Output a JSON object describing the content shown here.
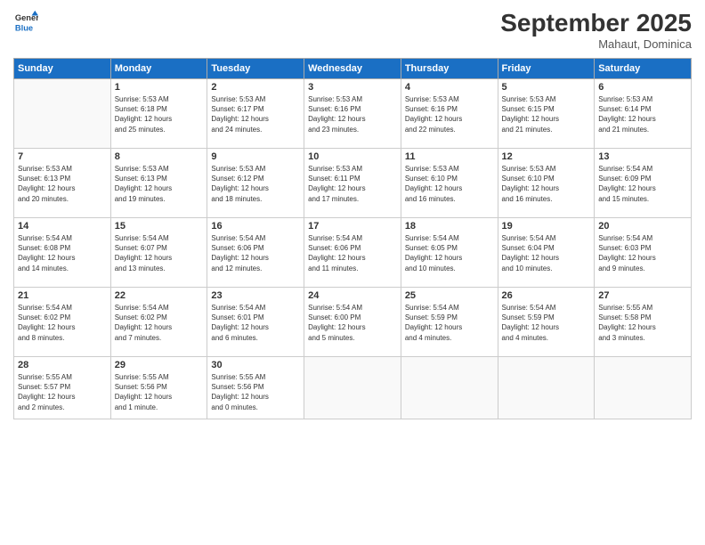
{
  "logo": {
    "general": "General",
    "blue": "Blue"
  },
  "header": {
    "title": "September 2025",
    "subtitle": "Mahaut, Dominica"
  },
  "weekdays": [
    "Sunday",
    "Monday",
    "Tuesday",
    "Wednesday",
    "Thursday",
    "Friday",
    "Saturday"
  ],
  "weeks": [
    [
      {
        "day": "",
        "info": ""
      },
      {
        "day": "1",
        "info": "Sunrise: 5:53 AM\nSunset: 6:18 PM\nDaylight: 12 hours\nand 25 minutes."
      },
      {
        "day": "2",
        "info": "Sunrise: 5:53 AM\nSunset: 6:17 PM\nDaylight: 12 hours\nand 24 minutes."
      },
      {
        "day": "3",
        "info": "Sunrise: 5:53 AM\nSunset: 6:16 PM\nDaylight: 12 hours\nand 23 minutes."
      },
      {
        "day": "4",
        "info": "Sunrise: 5:53 AM\nSunset: 6:16 PM\nDaylight: 12 hours\nand 22 minutes."
      },
      {
        "day": "5",
        "info": "Sunrise: 5:53 AM\nSunset: 6:15 PM\nDaylight: 12 hours\nand 21 minutes."
      },
      {
        "day": "6",
        "info": "Sunrise: 5:53 AM\nSunset: 6:14 PM\nDaylight: 12 hours\nand 21 minutes."
      }
    ],
    [
      {
        "day": "7",
        "info": "Sunrise: 5:53 AM\nSunset: 6:13 PM\nDaylight: 12 hours\nand 20 minutes."
      },
      {
        "day": "8",
        "info": "Sunrise: 5:53 AM\nSunset: 6:13 PM\nDaylight: 12 hours\nand 19 minutes."
      },
      {
        "day": "9",
        "info": "Sunrise: 5:53 AM\nSunset: 6:12 PM\nDaylight: 12 hours\nand 18 minutes."
      },
      {
        "day": "10",
        "info": "Sunrise: 5:53 AM\nSunset: 6:11 PM\nDaylight: 12 hours\nand 17 minutes."
      },
      {
        "day": "11",
        "info": "Sunrise: 5:53 AM\nSunset: 6:10 PM\nDaylight: 12 hours\nand 16 minutes."
      },
      {
        "day": "12",
        "info": "Sunrise: 5:53 AM\nSunset: 6:10 PM\nDaylight: 12 hours\nand 16 minutes."
      },
      {
        "day": "13",
        "info": "Sunrise: 5:54 AM\nSunset: 6:09 PM\nDaylight: 12 hours\nand 15 minutes."
      }
    ],
    [
      {
        "day": "14",
        "info": "Sunrise: 5:54 AM\nSunset: 6:08 PM\nDaylight: 12 hours\nand 14 minutes."
      },
      {
        "day": "15",
        "info": "Sunrise: 5:54 AM\nSunset: 6:07 PM\nDaylight: 12 hours\nand 13 minutes."
      },
      {
        "day": "16",
        "info": "Sunrise: 5:54 AM\nSunset: 6:06 PM\nDaylight: 12 hours\nand 12 minutes."
      },
      {
        "day": "17",
        "info": "Sunrise: 5:54 AM\nSunset: 6:06 PM\nDaylight: 12 hours\nand 11 minutes."
      },
      {
        "day": "18",
        "info": "Sunrise: 5:54 AM\nSunset: 6:05 PM\nDaylight: 12 hours\nand 10 minutes."
      },
      {
        "day": "19",
        "info": "Sunrise: 5:54 AM\nSunset: 6:04 PM\nDaylight: 12 hours\nand 10 minutes."
      },
      {
        "day": "20",
        "info": "Sunrise: 5:54 AM\nSunset: 6:03 PM\nDaylight: 12 hours\nand 9 minutes."
      }
    ],
    [
      {
        "day": "21",
        "info": "Sunrise: 5:54 AM\nSunset: 6:02 PM\nDaylight: 12 hours\nand 8 minutes."
      },
      {
        "day": "22",
        "info": "Sunrise: 5:54 AM\nSunset: 6:02 PM\nDaylight: 12 hours\nand 7 minutes."
      },
      {
        "day": "23",
        "info": "Sunrise: 5:54 AM\nSunset: 6:01 PM\nDaylight: 12 hours\nand 6 minutes."
      },
      {
        "day": "24",
        "info": "Sunrise: 5:54 AM\nSunset: 6:00 PM\nDaylight: 12 hours\nand 5 minutes."
      },
      {
        "day": "25",
        "info": "Sunrise: 5:54 AM\nSunset: 5:59 PM\nDaylight: 12 hours\nand 4 minutes."
      },
      {
        "day": "26",
        "info": "Sunrise: 5:54 AM\nSunset: 5:59 PM\nDaylight: 12 hours\nand 4 minutes."
      },
      {
        "day": "27",
        "info": "Sunrise: 5:55 AM\nSunset: 5:58 PM\nDaylight: 12 hours\nand 3 minutes."
      }
    ],
    [
      {
        "day": "28",
        "info": "Sunrise: 5:55 AM\nSunset: 5:57 PM\nDaylight: 12 hours\nand 2 minutes."
      },
      {
        "day": "29",
        "info": "Sunrise: 5:55 AM\nSunset: 5:56 PM\nDaylight: 12 hours\nand 1 minute."
      },
      {
        "day": "30",
        "info": "Sunrise: 5:55 AM\nSunset: 5:56 PM\nDaylight: 12 hours\nand 0 minutes."
      },
      {
        "day": "",
        "info": ""
      },
      {
        "day": "",
        "info": ""
      },
      {
        "day": "",
        "info": ""
      },
      {
        "day": "",
        "info": ""
      }
    ]
  ]
}
